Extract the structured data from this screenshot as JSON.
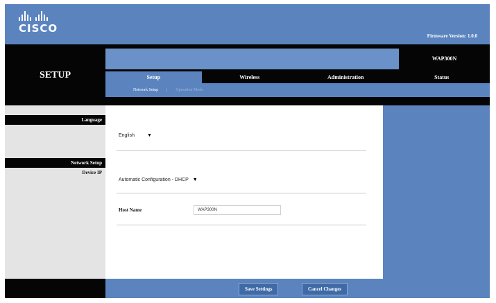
{
  "brand": {
    "logo_text": "CISCO"
  },
  "header": {
    "firmware": "Firmware Version: 1.0.0"
  },
  "page": {
    "section_title": "SETUP",
    "model": "WAP300N"
  },
  "tabs": [
    {
      "label": "Setup",
      "active": true
    },
    {
      "label": "Wireless",
      "active": false
    },
    {
      "label": "Administration",
      "active": false
    },
    {
      "label": "Status",
      "active": false
    }
  ],
  "subtabs": [
    {
      "label": "Network Setup",
      "active": true
    },
    {
      "label": "Operation Mode",
      "active": false
    }
  ],
  "sidebar": {
    "language_heading": "Language",
    "network_heading": "Network Setup",
    "device_ip_label": "Device IP"
  },
  "form": {
    "language_value": "English",
    "device_ip_mode": "Automatic Configuration - DHCP",
    "host_name_label": "Host Name",
    "host_name_value": "WAP300N"
  },
  "buttons": {
    "save": "Save Settings",
    "cancel": "Cancel Changes"
  },
  "colors": {
    "accent_blue": "#5b84bf",
    "dark_band": "#050505",
    "sidebar_gray": "#e4e4e4"
  }
}
